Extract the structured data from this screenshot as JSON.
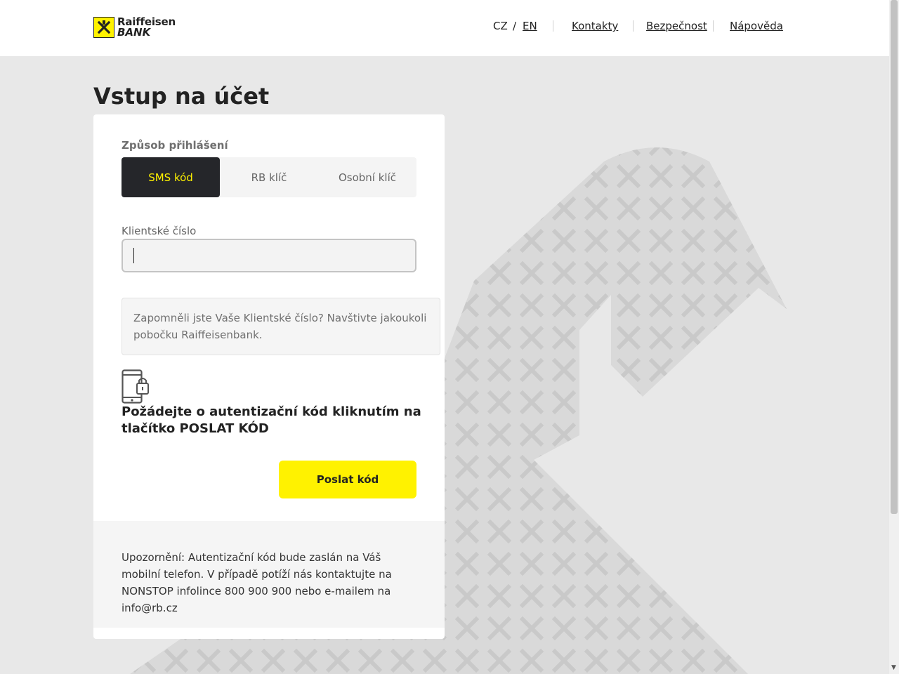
{
  "brand": {
    "line1": "Raiffeisen",
    "line2": "BANK"
  },
  "header": {
    "lang_cz": "CZ",
    "lang_sep": "/",
    "lang_en": "EN",
    "links": {
      "contacts": "Kontakty",
      "security": "Bezpečnost",
      "help": "Nápověda"
    }
  },
  "page_title": "Vstup na účet",
  "login": {
    "method_label": "Způsob přihlášení",
    "methods": [
      {
        "label": "SMS kód",
        "active": true
      },
      {
        "label": "RB klíč",
        "active": false
      },
      {
        "label": "Osobní klíč",
        "active": false
      }
    ],
    "client_number_label": "Klientské číslo",
    "client_number_value": "",
    "forgot_info": "Zapomněli jste Vaše Klientské číslo? Navštivte jakoukoli pobočku Raiffeisenbank.",
    "cta_text": "Požádejte o autentizační kód kliknutím na tlačítko POSLAT KÓD",
    "send_button": "Poslat kód",
    "notice": "Upozornění: Autentizační kód bude zaslán na Váš mobilní telefon. V případě potíží nás kontaktujte na NONSTOP infolince 800 900 900 nebo e-mailem na info@rb.cz"
  },
  "icons": {
    "logo": "raiffeisen-logo-icon",
    "phone": "phone-lock-icon",
    "background": "raiffeisen-pattern-arrow"
  },
  "colors": {
    "accent": "#fff200",
    "dark": "#25262a",
    "page_bg": "#e8e8e8"
  }
}
